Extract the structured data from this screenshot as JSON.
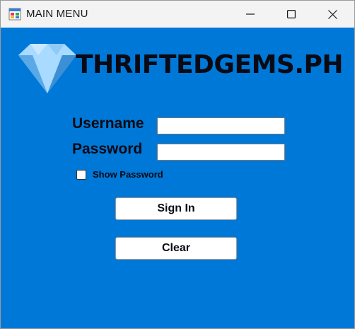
{
  "window": {
    "title": "MAIN MENU",
    "controls": {
      "minimize": "minimize",
      "maximize": "maximize",
      "close": "close"
    }
  },
  "brand": {
    "name": "THRIFTEDGEMS.PH",
    "gem_colors": [
      "#7ec3f5",
      "#a9daff",
      "#5aa9e6",
      "#3c8fd4"
    ]
  },
  "form": {
    "username_label": "Username",
    "username_value": "",
    "password_label": "Password",
    "password_value": "",
    "show_password_label": "Show Password",
    "show_password_checked": false
  },
  "buttons": {
    "sign_in": "Sign In",
    "clear": "Clear"
  },
  "colors": {
    "background": "#0078d7",
    "text": "#0a0a14"
  }
}
